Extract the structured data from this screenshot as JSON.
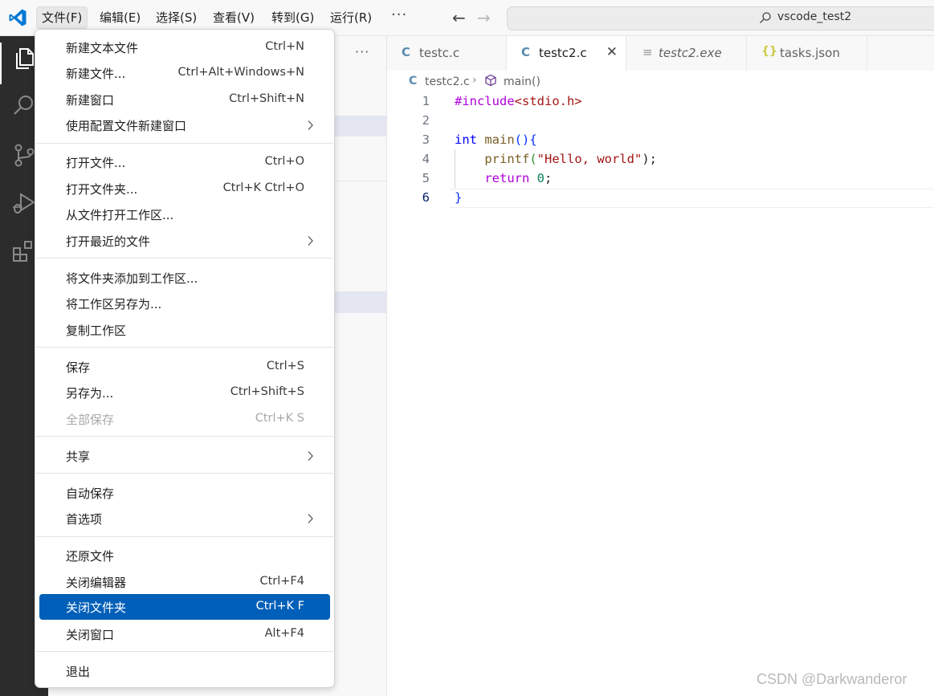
{
  "menubar": {
    "items": [
      "文件(F)",
      "编辑(E)",
      "选择(S)",
      "查看(V)",
      "转到(G)",
      "运行(R)"
    ],
    "more": "···"
  },
  "search": {
    "text": "vscode_test2"
  },
  "sidebar": {
    "more": "···"
  },
  "tabs": [
    {
      "label": "testc.c",
      "icon": "C"
    },
    {
      "label": "testc2.c",
      "icon": "C"
    },
    {
      "label": "testc2.exe",
      "icon": "≡"
    },
    {
      "label": "tasks.json",
      "icon": "{}"
    }
  ],
  "breadcrumb": {
    "file": "testc2.c",
    "symbol": "main()"
  },
  "editor": {
    "lines": [
      {
        "num": "1"
      },
      {
        "num": "2"
      },
      {
        "num": "3"
      },
      {
        "num": "4"
      },
      {
        "num": "5"
      },
      {
        "num": "6"
      }
    ],
    "code": {
      "include_kw": "#include",
      "include_hdr": "<stdio.h>",
      "int_kw": "int",
      "main_fn": "main",
      "paren_open_close": "()",
      "brace_open": "{",
      "printf_fn": "printf",
      "paren_open": "(",
      "string": "\"Hello, world\"",
      "paren_close_semi": ");",
      "return_kw": "return",
      "zero": "0",
      "semi": ";",
      "brace_close": "}"
    }
  },
  "file_menu": {
    "items": [
      {
        "label": "新建文本文件",
        "shortcut": "Ctrl+N"
      },
      {
        "label": "新建文件...",
        "shortcut": "Ctrl+Alt+Windows+N"
      },
      {
        "label": "新建窗口",
        "shortcut": "Ctrl+Shift+N"
      },
      {
        "label": "使用配置文件新建窗口",
        "shortcut": ""
      },
      {
        "label": "打开文件...",
        "shortcut": "Ctrl+O"
      },
      {
        "label": "打开文件夹...",
        "shortcut": "Ctrl+K Ctrl+O"
      },
      {
        "label": "从文件打开工作区...",
        "shortcut": ""
      },
      {
        "label": "打开最近的文件",
        "shortcut": ""
      },
      {
        "label": "将文件夹添加到工作区...",
        "shortcut": ""
      },
      {
        "label": "将工作区另存为...",
        "shortcut": ""
      },
      {
        "label": "复制工作区",
        "shortcut": ""
      },
      {
        "label": "保存",
        "shortcut": "Ctrl+S"
      },
      {
        "label": "另存为...",
        "shortcut": "Ctrl+Shift+S"
      },
      {
        "label": "全部保存",
        "shortcut": "Ctrl+K S"
      },
      {
        "label": "共享",
        "shortcut": ""
      },
      {
        "label": "自动保存",
        "shortcut": ""
      },
      {
        "label": "首选项",
        "shortcut": ""
      },
      {
        "label": "还原文件",
        "shortcut": ""
      },
      {
        "label": "关闭编辑器",
        "shortcut": "Ctrl+F4"
      },
      {
        "label": "关闭文件夹",
        "shortcut": "Ctrl+K F"
      },
      {
        "label": "关闭窗口",
        "shortcut": "Alt+F4"
      },
      {
        "label": "退出",
        "shortcut": ""
      }
    ]
  },
  "watermark": "CSDN @Darkwanderor",
  "colors": {
    "accent": "#005fb8",
    "activity_bar": "#2c2c2c",
    "c_icon": "#5a8bb0"
  },
  "icons": [
    "vscode-logo-icon",
    "files-icon",
    "search-icon",
    "source-control-icon",
    "run-debug-icon",
    "extensions-icon",
    "arrow-left-icon",
    "arrow-right-icon",
    "cube-icon",
    "chevron-right-icon",
    "close-icon"
  ]
}
